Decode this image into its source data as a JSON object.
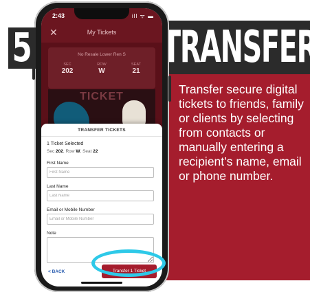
{
  "step": {
    "number": "5",
    "headline": "TRANSFER"
  },
  "promo": {
    "text": "Transfer secure digital tickets to friends, family or clients by selecting from contacts or manually entering a recipient’s name, email or phone number."
  },
  "status_bar": {
    "time": "2:43",
    "icons": "ill ᯤ ▬"
  },
  "app": {
    "title": "My Tickets",
    "close_icon": "✕"
  },
  "ticket": {
    "resale": "No Resale Lower Ren S",
    "sec_label": "SEC",
    "sec": "202",
    "row_label": "ROW",
    "row": "W",
    "seat_label": "SEAT",
    "seat": "21",
    "art_word": "TICKET"
  },
  "sheet": {
    "title": "TRANSFER TICKETS",
    "selected": "1 Ticket Selected",
    "seat_prefix_sec": "Sec",
    "seat_sec": "202",
    "seat_prefix_row": ", Row",
    "seat_row": "W",
    "seat_prefix_seat": ", Seat",
    "seat_seat": "22",
    "first_name_label": "First Name",
    "first_name_placeholder": "First Name",
    "last_name_label": "Last Name",
    "last_name_placeholder": "Last Name",
    "email_label": "Email or Mobile Number",
    "email_placeholder": "Email or Mobile Number",
    "note_label": "Note",
    "back": "< BACK",
    "transfer_button": "Transfer 1 Ticket"
  },
  "colors": {
    "brand_red": "#a51d2d",
    "header_red": "#6b1620",
    "highlight": "#2ec9e8",
    "dark": "#2b2b2b"
  }
}
